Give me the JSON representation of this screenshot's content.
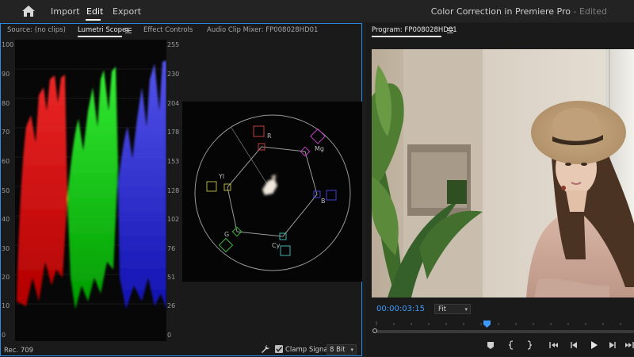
{
  "header": {
    "nav": [
      "Import",
      "Edit",
      "Export"
    ],
    "title": "Color Correction in Premiere Pro",
    "title_separator": " - ",
    "title_state": "Edited"
  },
  "source_panel": {
    "tabs": [
      "Source: (no clips)",
      "Lumetri Scopes",
      "Effect Controls",
      "Audio Clip Mixer: FP008028HD01"
    ],
    "parade_left_ticks": [
      "100",
      "90",
      "80",
      "70",
      "60",
      "50",
      "40",
      "30",
      "20",
      "10",
      "0"
    ],
    "parade_right_ticks": [
      "255",
      "230",
      "204",
      "178",
      "153",
      "128",
      "102",
      "76",
      "51",
      "26",
      "0"
    ],
    "vectorscope_labels": [
      "R",
      "Mg",
      "B",
      "Cy",
      "G",
      "Yl"
    ],
    "footer": {
      "colorspace": "Rec. 709",
      "clamp_label": "Clamp Signal",
      "clamp_checked": true,
      "bit_depth": "8 Bit"
    }
  },
  "program_panel": {
    "title": "Program: FP008028HD01",
    "timecode": "00:00:03:15",
    "zoom": "Fit",
    "accent_color": "#3d9bff"
  }
}
